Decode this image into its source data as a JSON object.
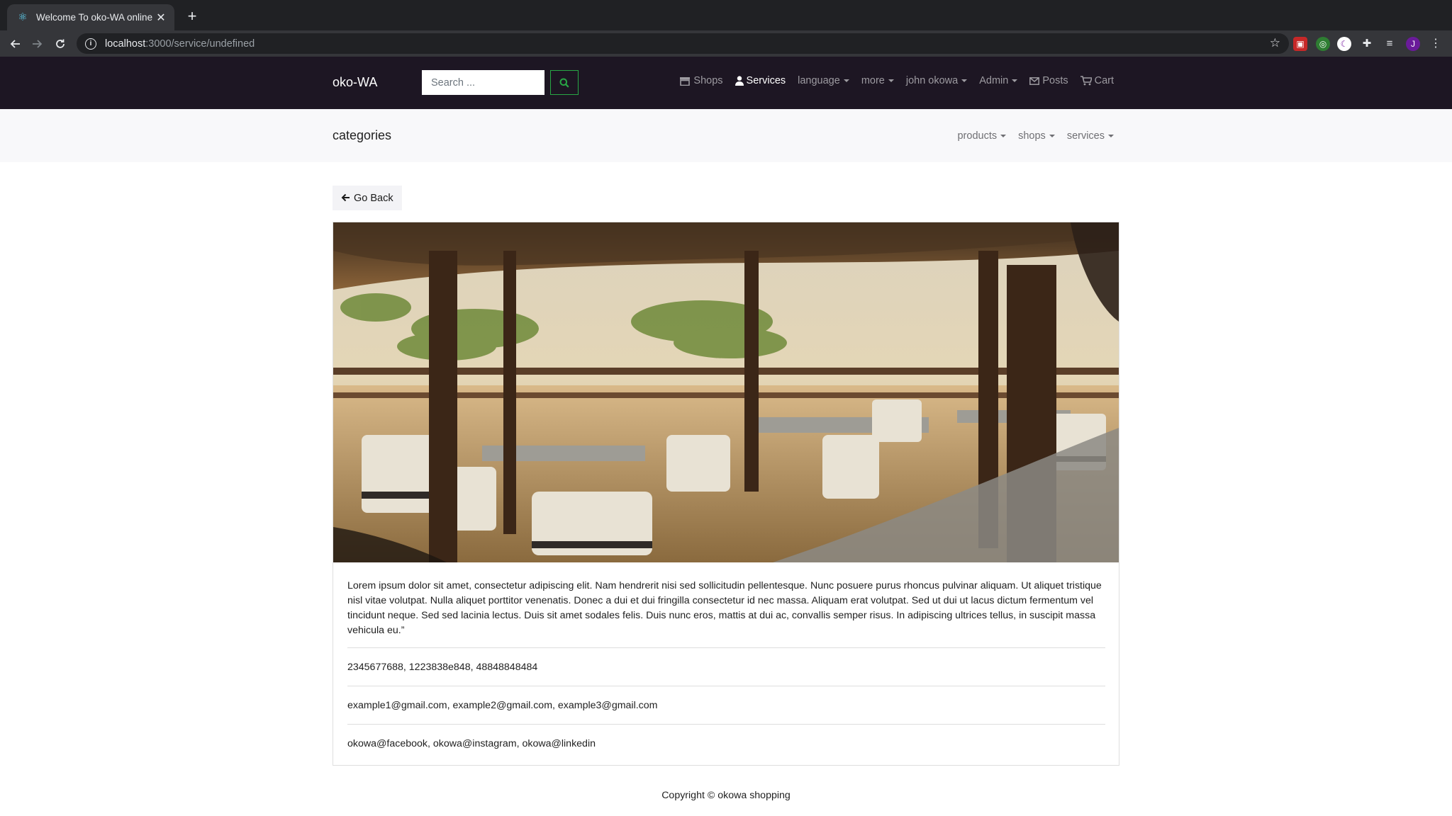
{
  "browser": {
    "tab_title": "Welcome To oko-WA online St",
    "new_tab_symbol": "+",
    "url_host": "localhost",
    "url_path": ":3000/service/undefined",
    "profile_initial": "J"
  },
  "navbar": {
    "brand": "oko-WA",
    "search_placeholder": "Search ...",
    "links": {
      "shops": "Shops",
      "services": "Services",
      "language": "language",
      "more": "more",
      "user": "john okowa",
      "admin": "Admin",
      "posts": "Posts",
      "cart": "Cart"
    },
    "active": "services",
    "colors": {
      "background": "#1d1623",
      "search_button_border": "#28a745"
    }
  },
  "categories": {
    "title": "categories",
    "menus": {
      "products": "products",
      "shops": "shops",
      "services": "services"
    }
  },
  "content": {
    "go_back": "Go Back",
    "image_icon": "beach-restaurant-photo",
    "description": "Lorem ipsum dolor sit amet, consectetur adipiscing elit. Nam hendrerit nisi sed sollicitudin pellentesque. Nunc posuere purus rhoncus pulvinar aliquam. Ut aliquet tristique nisl vitae volutpat. Nulla aliquet porttitor venenatis. Donec a dui et dui fringilla consectetur id nec massa. Aliquam erat volutpat. Sed ut dui ut lacus dictum fermentum vel tincidunt neque. Sed sed lacinia lectus. Duis sit amet sodales felis. Duis nunc eros, mattis at dui ac, convallis semper risus. In adipiscing ultrices tellus, in suscipit massa vehicula eu.”",
    "phones": "2345677688, 1223838e848, 48848848484",
    "emails": "example1@gmail.com, example2@gmail.com, example3@gmail.com",
    "socials": "okowa@facebook, okowa@instagram, okowa@linkedin"
  },
  "footer": {
    "copyright": "Copyright © okowa shopping"
  }
}
